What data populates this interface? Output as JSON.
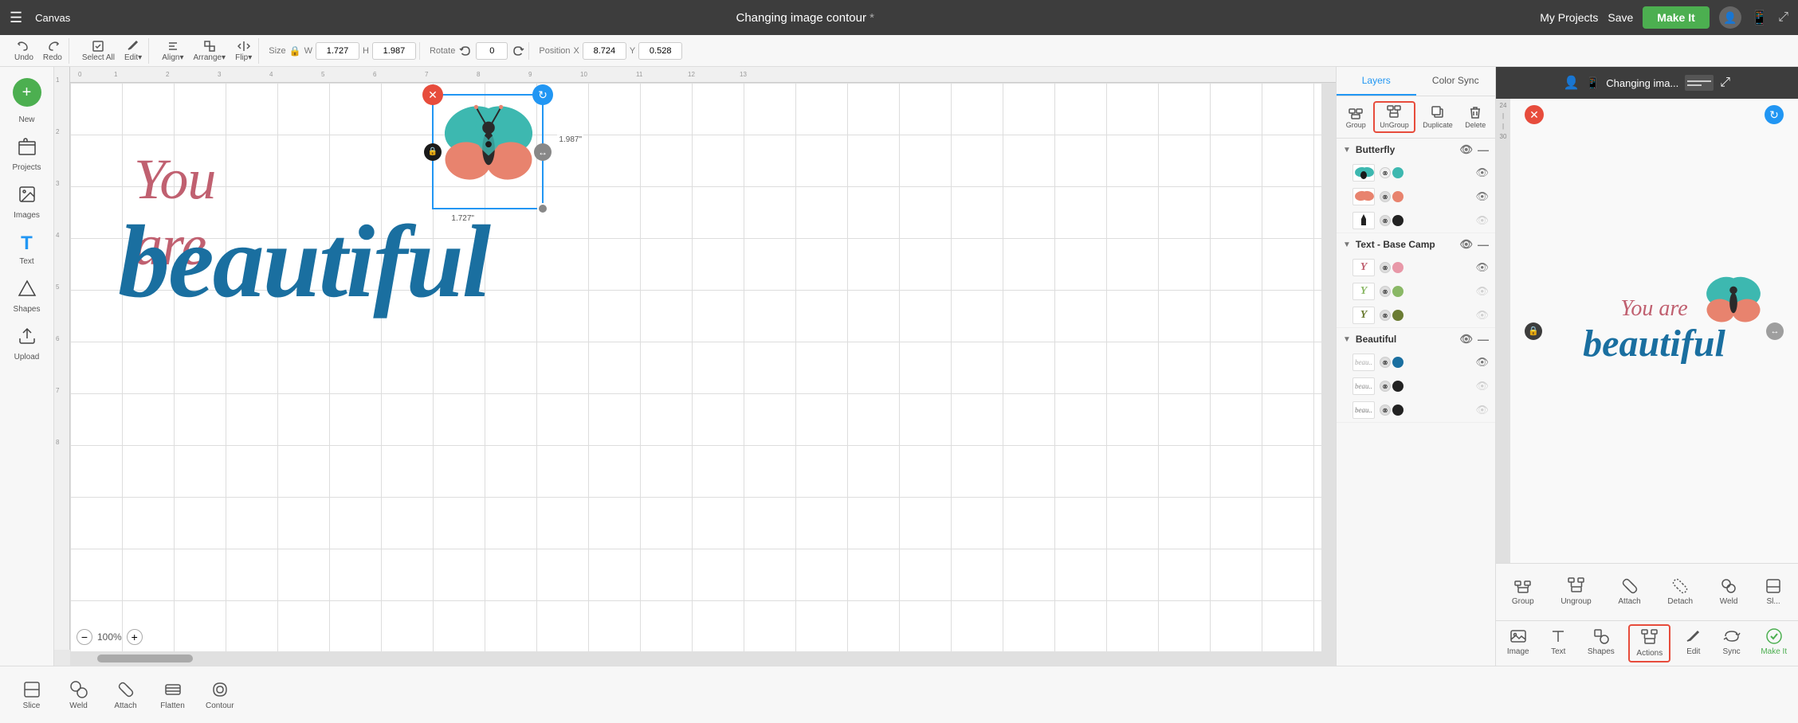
{
  "app": {
    "title": "Canvas",
    "document_title": "Changing image contour",
    "document_title_short": "Changing ima...",
    "modified": true
  },
  "topbar": {
    "menu_icon": "☰",
    "my_projects": "My Projects",
    "save": "Save",
    "make_it": "Make It"
  },
  "toolbar": {
    "undo": "Undo",
    "redo": "Redo",
    "select_all": "Select All",
    "edit": "Edit▾",
    "align": "Align▾",
    "arrange": "Arrange▾",
    "flip": "Flip▾",
    "size_label": "Size",
    "lock_icon": "🔒",
    "w_label": "W",
    "w_value": "1.727",
    "h_label": "H",
    "h_value": "1.987",
    "rotate_label": "Rotate",
    "rotate_value": "0",
    "position_label": "Position",
    "x_label": "X",
    "x_value": "8.724",
    "y_label": "Y",
    "y_value": "0.528"
  },
  "sidebar": {
    "items": [
      {
        "id": "new",
        "label": "New",
        "icon": "+"
      },
      {
        "id": "projects",
        "label": "Projects",
        "icon": "📁"
      },
      {
        "id": "images",
        "label": "Images",
        "icon": "🖼"
      },
      {
        "id": "text",
        "label": "Text",
        "icon": "T"
      },
      {
        "id": "shapes",
        "label": "Shapes",
        "icon": "◇"
      },
      {
        "id": "upload",
        "label": "Upload",
        "icon": "⬆"
      }
    ]
  },
  "canvas": {
    "zoom": "100%",
    "design_text1": "You are",
    "design_text2": "beautiful",
    "butterfly_dim_w": "1.727\"",
    "butterfly_dim_h": "1.987\""
  },
  "layers_panel": {
    "tabs": [
      "Layers",
      "Color Sync"
    ],
    "active_tab": "Layers",
    "toolbar_buttons": [
      {
        "id": "group",
        "label": "Group"
      },
      {
        "id": "ungroup",
        "label": "UnGroup",
        "active": true
      },
      {
        "id": "duplicate",
        "label": "Duplicate"
      },
      {
        "id": "delete",
        "label": "Delete"
      }
    ],
    "groups": [
      {
        "id": "butterfly",
        "name": "Butterfly",
        "expanded": true,
        "visible": true,
        "items": [
          {
            "id": "b1",
            "colors": [
              "#3db8b0",
              "#e8836e"
            ],
            "visible": true
          },
          {
            "id": "b2",
            "colors": [
              "#e8836e",
              "#f0a070"
            ],
            "visible": true
          },
          {
            "id": "b3",
            "colors": [
              "#222222"
            ],
            "visible": false
          }
        ]
      },
      {
        "id": "text-base-camp",
        "name": "Text - Base Camp",
        "expanded": true,
        "visible": true,
        "items": [
          {
            "id": "tbc1",
            "colors": [
              "#c06070",
              "#f0c0c8"
            ],
            "visible": true
          },
          {
            "id": "tbc2",
            "colors": [
              "#8ab866",
              "#c0d070"
            ],
            "visible": false
          },
          {
            "id": "tbc3",
            "colors": [
              "#6b7c33",
              "#4a5a20"
            ],
            "visible": false
          }
        ]
      },
      {
        "id": "beautiful",
        "name": "Beautiful",
        "expanded": true,
        "visible": true,
        "items": [
          {
            "id": "beau1",
            "colors": [
              "#aaaaaa",
              "#1a6fa0"
            ],
            "visible": true
          },
          {
            "id": "beau2",
            "colors": [
              "#aaaaaa",
              "#222222"
            ],
            "visible": false
          },
          {
            "id": "beau3",
            "colors": [
              "#888888",
              "#222222"
            ],
            "visible": false
          }
        ]
      }
    ]
  },
  "preview": {
    "title": "Changing ima...",
    "design_text1": "You are",
    "design_text2": "beautiful"
  },
  "bottom_bar_canvas": {
    "buttons": [
      {
        "id": "slice",
        "label": "Slice"
      },
      {
        "id": "weld",
        "label": "Weld"
      },
      {
        "id": "attach",
        "label": "Attach"
      },
      {
        "id": "flatten",
        "label": "Flatten"
      },
      {
        "id": "contour",
        "label": "Contour"
      }
    ]
  },
  "bottom_bar_preview": {
    "buttons": [
      {
        "id": "group",
        "label": "Group"
      },
      {
        "id": "ungroup",
        "label": "Ungroup"
      },
      {
        "id": "attach",
        "label": "Attach"
      },
      {
        "id": "detach",
        "label": "Detach"
      },
      {
        "id": "weld",
        "label": "Weld"
      },
      {
        "id": "slice2",
        "label": "Sl..."
      }
    ],
    "row2": [
      {
        "id": "image",
        "label": "Image"
      },
      {
        "id": "text",
        "label": "Text"
      },
      {
        "id": "shapes",
        "label": "Shapes"
      },
      {
        "id": "actions",
        "label": "Actions",
        "highlighted": true
      },
      {
        "id": "edit",
        "label": "Edit"
      },
      {
        "id": "sync",
        "label": "Sync"
      },
      {
        "id": "make_it",
        "label": "Make It",
        "green": true
      }
    ]
  }
}
